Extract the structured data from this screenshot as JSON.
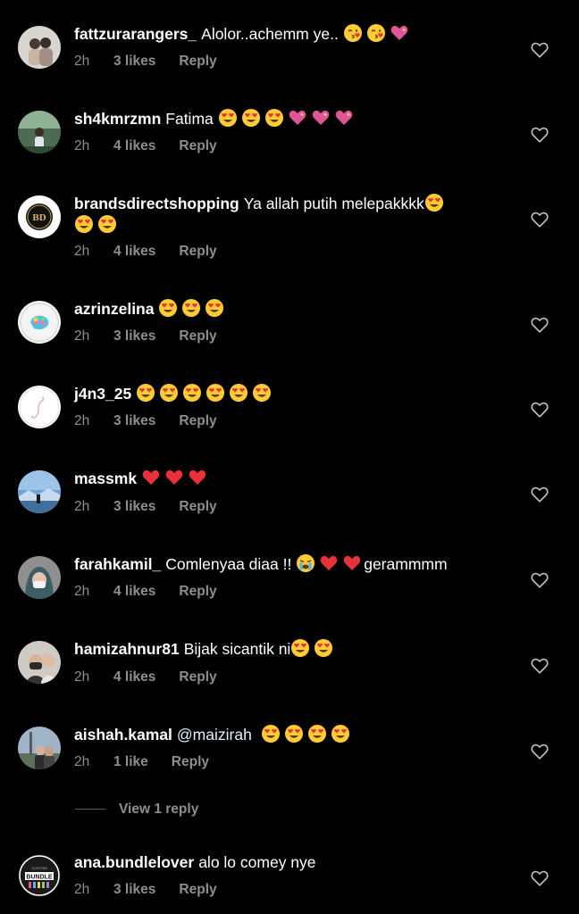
{
  "colors": {
    "background": "#000000",
    "text": "#ffffff",
    "meta": "#8e8e8e",
    "heart_red": "#e8323a",
    "emoji_yellow": "#ffcc33"
  },
  "comments": [
    {
      "username": "fattzurarangers_",
      "text": "Alolor..achemm ye..",
      "emojis": [
        "kissing-heart-emoji",
        "kissing-heart-emoji",
        "sparkling-heart-emoji"
      ],
      "time": "2h",
      "likes": "3 likes",
      "reply": "Reply"
    },
    {
      "username": "sh4kmrzmn",
      "text": "Fatima",
      "emojis": [
        "heart-eyes-emoji",
        "heart-eyes-emoji",
        "heart-eyes-emoji",
        "sparkling-heart-emoji",
        "sparkling-heart-emoji",
        "sparkling-heart-emoji"
      ],
      "time": "2h",
      "likes": "4 likes",
      "reply": "Reply"
    },
    {
      "username": "brandsdirectshopping",
      "text": "Ya allah putih melepakkkk",
      "emojis": [
        "heart-eyes-emoji"
      ],
      "text_line2_emojis": [
        "heart-eyes-emoji",
        "heart-eyes-emoji"
      ],
      "time": "2h",
      "likes": "4 likes",
      "reply": "Reply"
    },
    {
      "username": "azrinzelina",
      "text": "",
      "emojis": [
        "heart-eyes-emoji",
        "heart-eyes-emoji",
        "heart-eyes-emoji"
      ],
      "time": "2h",
      "likes": "3 likes",
      "reply": "Reply"
    },
    {
      "username": "j4n3_25",
      "text": "",
      "emojis": [
        "heart-eyes-emoji",
        "heart-eyes-emoji",
        "heart-eyes-emoji",
        "heart-eyes-emoji",
        "heart-eyes-emoji",
        "heart-eyes-emoji"
      ],
      "time": "2h",
      "likes": "3 likes",
      "reply": "Reply"
    },
    {
      "username": "massmk",
      "text": "",
      "emojis": [
        "red-heart-emoji",
        "red-heart-emoji",
        "red-heart-emoji"
      ],
      "time": "2h",
      "likes": "3 likes",
      "reply": "Reply"
    },
    {
      "username": "farahkamil_",
      "text": "Comlenyaa diaa !!",
      "emojis": [
        "crying-emoji",
        "red-heart-emoji",
        "red-heart-emoji"
      ],
      "text_after": "gerammmm",
      "time": "2h",
      "likes": "4 likes",
      "reply": "Reply"
    },
    {
      "username": "hamizahnur81",
      "text": "Bijak sicantik ni",
      "emojis": [
        "heart-eyes-emoji",
        "heart-eyes-emoji"
      ],
      "time": "2h",
      "likes": "4 likes",
      "reply": "Reply"
    },
    {
      "username": "aishah.kamal",
      "text": "@maizirah",
      "emojis": [
        "heart-eyes-emoji",
        "heart-eyes-emoji",
        "heart-eyes-emoji",
        "heart-eyes-emoji"
      ],
      "time": "2h",
      "likes": "1 like",
      "reply": "Reply"
    },
    {
      "username": "ana.bundlelover",
      "text": "alo lo comey nye",
      "emojis": [],
      "time": "2h",
      "likes": "3 likes",
      "reply": "Reply"
    }
  ],
  "view_replies": "View 1 reply",
  "avatar_texts": {
    "brandsdirect": "BD",
    "bundle_top": "CUSTOM",
    "bundle_main": "BUNDLE"
  }
}
